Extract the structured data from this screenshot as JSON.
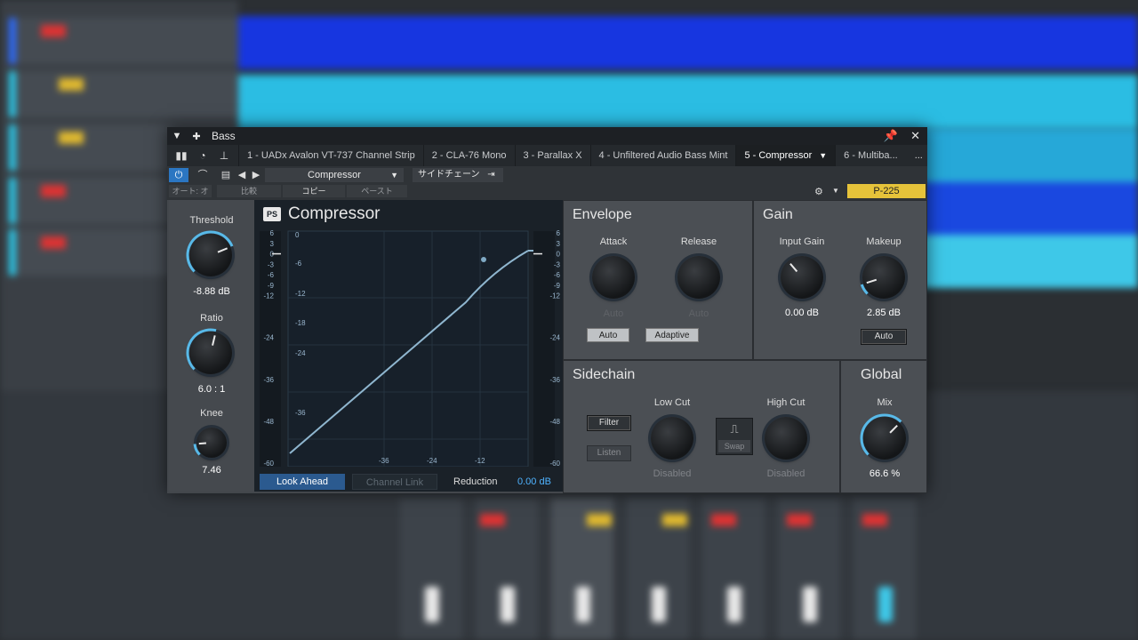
{
  "window": {
    "title": "Bass",
    "tabs": [
      {
        "label": "1 - UADx Avalon VT-737 Channel Strip",
        "active": false
      },
      {
        "label": "2 - CLA-76 Mono",
        "active": false
      },
      {
        "label": "3 - Parallax X",
        "active": false
      },
      {
        "label": "4 - Unfiltered Audio Bass Mint",
        "active": false
      },
      {
        "label": "5 - Compressor",
        "active": true
      },
      {
        "label": "6 - Multiba...",
        "active": false
      }
    ],
    "more_label": "..."
  },
  "toolbar": {
    "preset_name": "Compressor",
    "sidechain_label": "サイドチェーン",
    "auto_off": "オート: オフ",
    "compare": "比較",
    "copy": "コピー",
    "paste": "ペースト",
    "badge": "P-225"
  },
  "left": {
    "threshold": {
      "label": "Threshold",
      "value": "-8.88 dB",
      "level": 0.75
    },
    "ratio": {
      "label": "Ratio",
      "value": "6.0 : 1",
      "level": 0.55
    },
    "knee": {
      "label": "Knee",
      "value": "7.46",
      "level": 0.15
    }
  },
  "graph": {
    "title": "Compressor",
    "logo": "PS",
    "left_scale": [
      "6",
      "3",
      "0",
      "-3",
      "-6",
      "-9",
      "-12",
      "-24",
      "-36",
      "-48",
      "-60"
    ],
    "right_scale": [
      "6",
      "3",
      "0",
      "-3",
      "-6",
      "-9",
      "-12",
      "-24",
      "-36",
      "-48",
      "-60"
    ],
    "y_axis_labels": [
      "0",
      "-6",
      "-12",
      "-18",
      "-24",
      "-36"
    ],
    "x_axis_labels": [
      "-36",
      "-24",
      "-12"
    ],
    "look_ahead": "Look Ahead",
    "channel_link": "Channel Link",
    "reduction_label": "Reduction",
    "reduction_value": "0.00 dB"
  },
  "envelope": {
    "title": "Envelope",
    "attack": {
      "label": "Attack",
      "auto_label": "Auto",
      "button": "Auto"
    },
    "release": {
      "label": "Release",
      "auto_label": "Auto",
      "button": "Adaptive"
    }
  },
  "gain": {
    "title": "Gain",
    "input": {
      "label": "Input Gain",
      "value": "0.00 dB",
      "level": 0.35
    },
    "makeup": {
      "label": "Makeup",
      "value": "2.85 dB",
      "level": 0.1,
      "button": "Auto"
    }
  },
  "sidechain": {
    "title": "Sidechain",
    "filter_button": "Filter",
    "listen_button": "Listen",
    "low_cut": {
      "label": "Low Cut",
      "value": "Disabled"
    },
    "swap_label": "Swap",
    "high_cut": {
      "label": "High Cut",
      "value": "Disabled"
    }
  },
  "global": {
    "title": "Global",
    "mix": {
      "label": "Mix",
      "value": "66.6 %",
      "level": 0.666
    }
  },
  "colors": {
    "accent": "#2b76c2",
    "ring": "#58b9e8",
    "badge": "#e6c33a"
  }
}
